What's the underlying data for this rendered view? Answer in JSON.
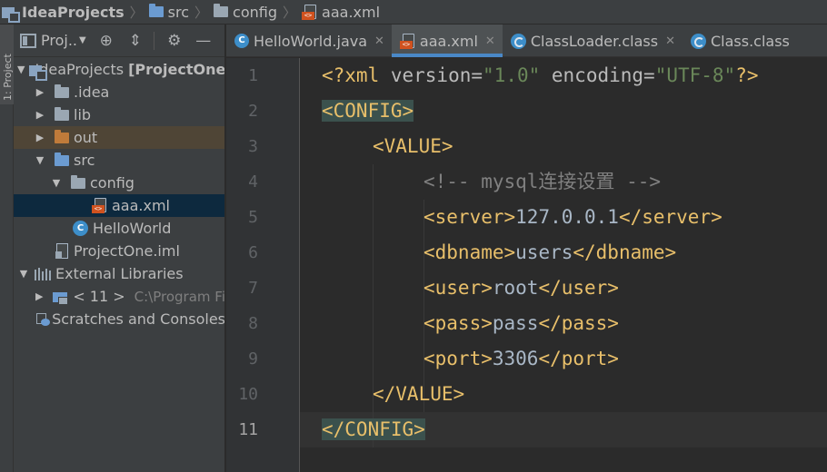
{
  "breadcrumb": {
    "project": "IdeaProjects",
    "items": [
      "src",
      "config",
      "aaa.xml"
    ]
  },
  "tool_strip": {
    "project_tab": "1: Project"
  },
  "project_panel": {
    "title": "Proj..",
    "header_icons": [
      "dropdown-icon",
      "locate-icon",
      "collapse-icon",
      "gear-icon",
      "minimize-icon"
    ],
    "tree": {
      "root_label": "IdeaProjects",
      "root_module": "[ProjectOne",
      "idea": ".idea",
      "lib": "lib",
      "out": "out",
      "src": "src",
      "config": "config",
      "aaa_xml": "aaa.xml",
      "helloworld": "HelloWorld",
      "iml": "ProjectOne.iml",
      "external_libraries": "External Libraries",
      "sdk": "< 11 >",
      "sdk_path": "C:\\Program Fi",
      "scratches": "Scratches and Consoles"
    }
  },
  "tabs": [
    {
      "label": "HelloWorld.java",
      "icon": "java-class-icon",
      "active": false
    },
    {
      "label": "aaa.xml",
      "icon": "xml-file-icon",
      "active": true
    },
    {
      "label": "ClassLoader.class",
      "icon": "class-file-icon",
      "active": false
    },
    {
      "label": "Class.class",
      "icon": "class-file-icon",
      "active": false
    }
  ],
  "editor": {
    "line_numbers": [
      "1",
      "2",
      "3",
      "4",
      "5",
      "6",
      "7",
      "8",
      "9",
      "10",
      "11"
    ],
    "current_line": "11",
    "lines": {
      "l1": {
        "open": "<?xml",
        "attr1": " version",
        "eq1": "=",
        "val1": "\"1.0\"",
        "attr2": " encoding",
        "eq2": "=",
        "val2": "\"UTF-8\"",
        "close": "?>"
      },
      "l2": {
        "tag": "<CONFIG>"
      },
      "l3": {
        "tag": "<VALUE>"
      },
      "l4": {
        "comment": "<!-- mysql连接设置 -->"
      },
      "l5": {
        "open": "<server>",
        "text": "127.0.0.1",
        "close": "</server>"
      },
      "l6": {
        "open": "<dbname>",
        "text": "users",
        "close": "</dbname>"
      },
      "l7": {
        "open": "<user>",
        "text": "root",
        "close": "</user>"
      },
      "l8": {
        "open": "<pass>",
        "text": "pass",
        "close": "</pass>"
      },
      "l9": {
        "open": "<port>",
        "text": "3306",
        "close": "</port>"
      },
      "l10": {
        "tag": "</VALUE>"
      },
      "l11": {
        "tag": "</CONFIG>"
      }
    }
  },
  "colors": {
    "editor_bg": "#2b2b2b",
    "tag": "#e8bf6a",
    "string": "#6a8759",
    "comment": "#808080",
    "text": "#a9b7c6",
    "active_tab_underline": "#4a88c7",
    "selection": "#0d293e"
  }
}
